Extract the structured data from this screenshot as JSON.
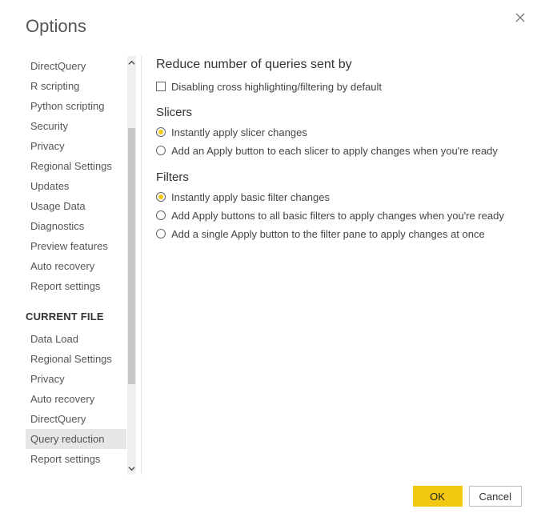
{
  "title": "Options",
  "sidebar": {
    "global_items": [
      "DirectQuery",
      "R scripting",
      "Python scripting",
      "Security",
      "Privacy",
      "Regional Settings",
      "Updates",
      "Usage Data",
      "Diagnostics",
      "Preview features",
      "Auto recovery",
      "Report settings"
    ],
    "section_header": "CURRENT FILE",
    "file_items": [
      "Data Load",
      "Regional Settings",
      "Privacy",
      "Auto recovery",
      "DirectQuery",
      "Query reduction",
      "Report settings"
    ],
    "selected": "Query reduction"
  },
  "main": {
    "heading": "Reduce number of queries sent by",
    "checkbox_label": "Disabling cross highlighting/filtering by default",
    "slicers_heading": "Slicers",
    "slicer_options": [
      "Instantly apply slicer changes",
      "Add an Apply button to each slicer to apply changes when you're ready"
    ],
    "slicer_selected": 0,
    "filters_heading": "Filters",
    "filter_options": [
      "Instantly apply basic filter changes",
      "Add Apply buttons to all basic filters to apply changes when you're ready",
      "Add a single Apply button to the filter pane to apply changes at once"
    ],
    "filter_selected": 0
  },
  "footer": {
    "ok": "OK",
    "cancel": "Cancel"
  }
}
